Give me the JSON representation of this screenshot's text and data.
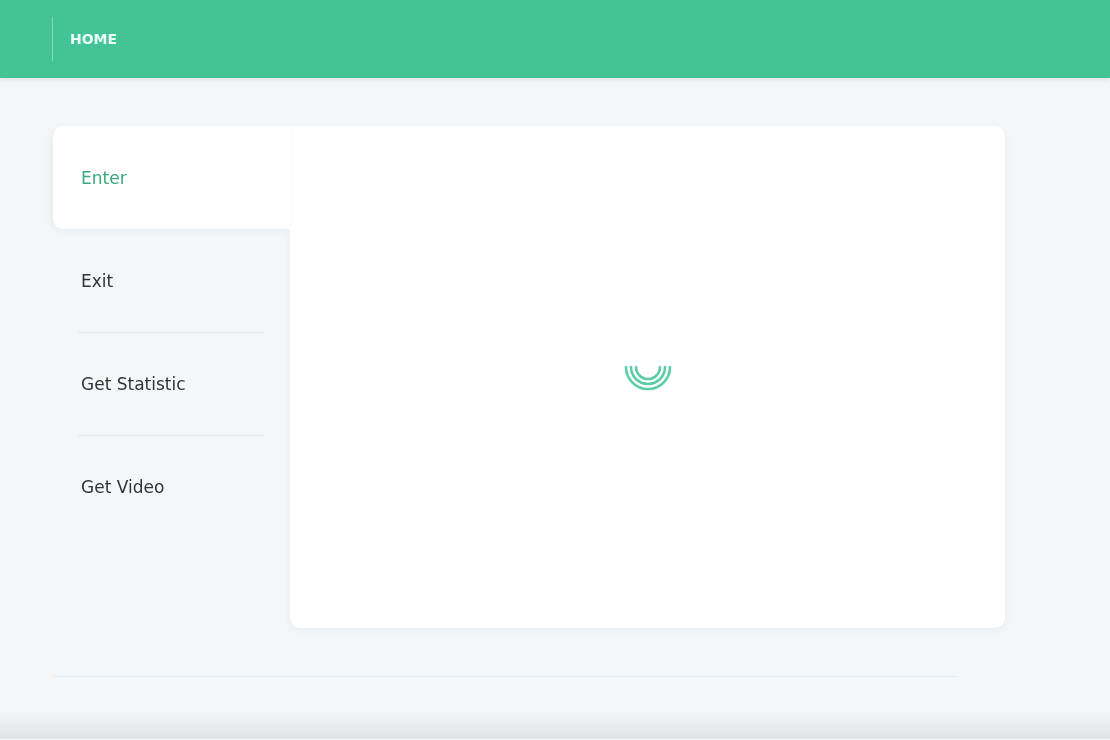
{
  "header": {
    "title": "HOME"
  },
  "tabs": [
    {
      "label": "Enter",
      "selected": true
    },
    {
      "label": "Exit",
      "selected": false
    },
    {
      "label": "Get Statistic",
      "selected": false
    },
    {
      "label": "Get Video",
      "selected": false
    }
  ],
  "content": {
    "loading": true
  }
}
